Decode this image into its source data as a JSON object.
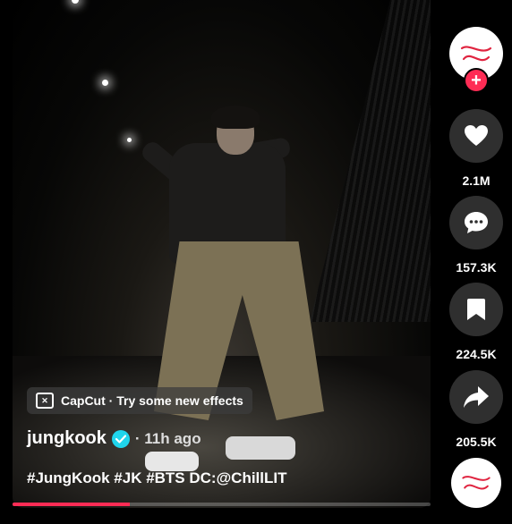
{
  "video": {
    "effect_banner": "CapCut · Try some new effects",
    "username": "jungkook",
    "timestamp": "· 11h ago",
    "caption": "#JungKook #JK #BTS DC:@ChillLIT",
    "progress_percent": 28
  },
  "actions": {
    "likes": "2.1M",
    "comments": "157.3K",
    "saves": "224.5K",
    "shares": "205.5K"
  },
  "icons": {
    "avatar": "brand-logo-icon",
    "follow": "plus-icon",
    "like": "heart-icon",
    "comment": "comment-bubble-icon",
    "save": "bookmark-icon",
    "share": "share-arrow-icon",
    "music": "music-disc-icon",
    "effect": "capcut-icon"
  },
  "colors": {
    "accent": "#fe2c55",
    "verified": "#20d5ec",
    "action_bg": "#2f2f2f"
  }
}
